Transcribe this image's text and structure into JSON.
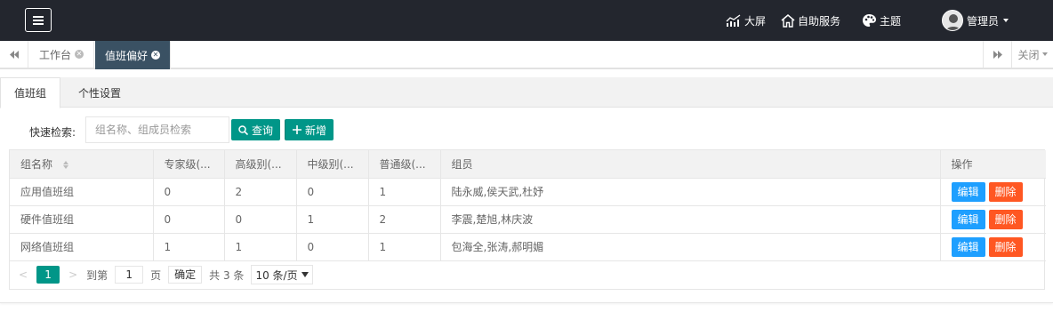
{
  "header": {
    "nav": [
      {
        "label": "大屏",
        "icon": "bar-chart-icon"
      },
      {
        "label": "自助服务",
        "icon": "home-icon"
      },
      {
        "label": "主题",
        "icon": "palette-icon"
      },
      {
        "label": "管理员",
        "icon": "avatar"
      }
    ]
  },
  "tabs": {
    "items": [
      {
        "label": "工作台"
      },
      {
        "label": "值班偏好"
      }
    ],
    "close_label": "关闭"
  },
  "subtabs": [
    "值班组",
    "个性设置"
  ],
  "search": {
    "label": "快速检索:",
    "placeholder": "组名称、组成员检索",
    "query_label": "查询",
    "add_label": "新增"
  },
  "table": {
    "columns": [
      "组名称",
      "专家级(...",
      "高级别(...",
      "中级别(...",
      "普通级(...",
      "组员",
      "操作"
    ],
    "rows": [
      {
        "name": "应用值班组",
        "expert": "0",
        "high": "2",
        "mid": "0",
        "normal": "1",
        "members": "陆永威,侯天武,杜妤"
      },
      {
        "name": "硬件值班组",
        "expert": "0",
        "high": "0",
        "mid": "1",
        "normal": "2",
        "members": "李震,楚旭,林庆波"
      },
      {
        "name": "网络值班组",
        "expert": "1",
        "high": "1",
        "mid": "0",
        "normal": "1",
        "members": "包海全,张涛,郝明媚"
      }
    ],
    "edit_label": "编辑",
    "delete_label": "删除"
  },
  "pager": {
    "current": "1",
    "goto_label": "到第",
    "goto_value": "1",
    "page_label": "页",
    "confirm_label": "确定",
    "total_label": "共 3 条",
    "size_label": "10 条/页"
  },
  "colors": {
    "header_bg": "#23262e",
    "active_tab_bg": "#3a5163",
    "primary": "#009688",
    "edit": "#1e9fff",
    "delete": "#ff5722"
  }
}
